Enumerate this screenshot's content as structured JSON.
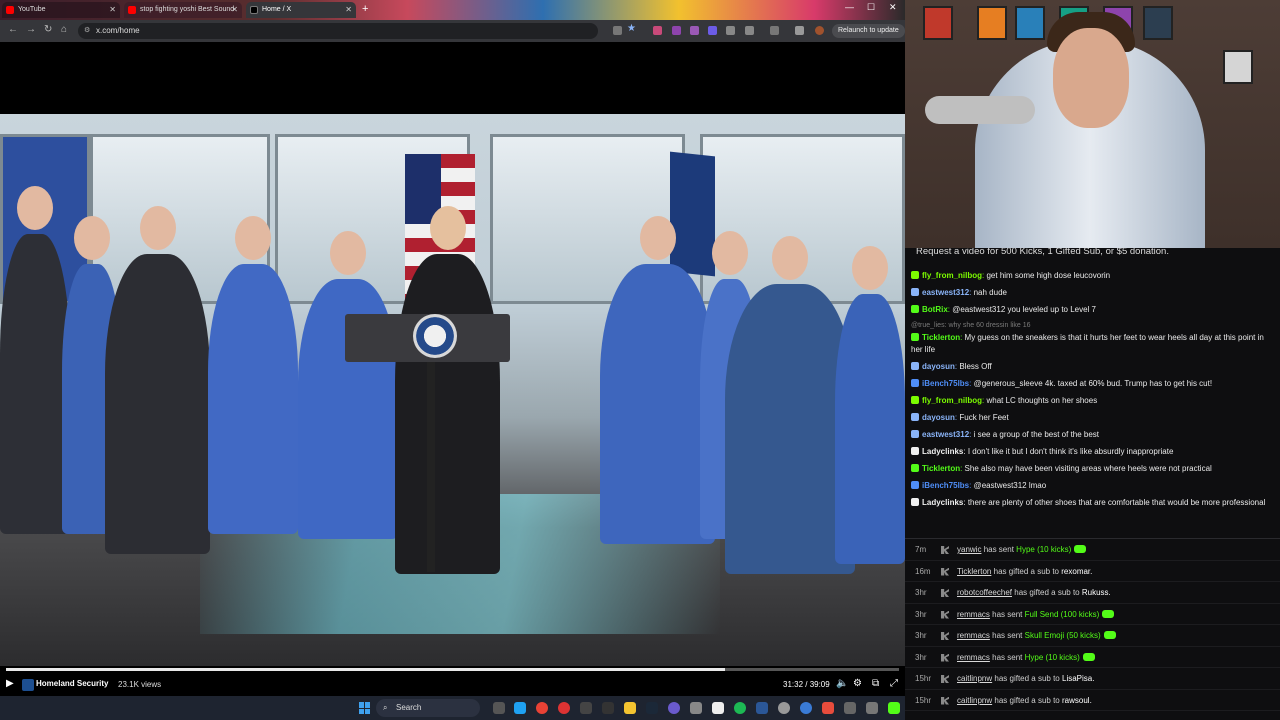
{
  "browser": {
    "tabs": [
      {
        "label": "YouTube"
      },
      {
        "label": "stop fighting yoshi Best Sound"
      },
      {
        "label": "Home / X"
      }
    ],
    "new_tab": "+",
    "url": "x.com/home",
    "relaunch_label": "Relaunch to update"
  },
  "video": {
    "channel": "Homeland Security",
    "views": "23.1K views",
    "time": "31:32 / 39:09",
    "progress_fraction": 0.805
  },
  "chat": {
    "banner": "Request a video for 500 Kicks, 1 Gifted Sub, or $5 donation.",
    "messages": [
      {
        "user": "fly_from_nilbog",
        "text": "get him some high dose leucovorin",
        "color": "#7cfc00"
      },
      {
        "user": "eastwest312",
        "text": "nah dude",
        "color": "#8ab4f8"
      },
      {
        "user": "BotRix",
        "text": "@eastwest312 you leveled up to Level 7",
        "color": "#53fc18"
      },
      {
        "deleted": "@true_lies: why she 60 dressin like 16"
      },
      {
        "user": "Ticklerton",
        "text": "My guess on the sneakers is that it hurts her feet to wear heels all day at this point in her life",
        "color": "#53fc18"
      },
      {
        "user": "dayosun",
        "text": "Bless Off",
        "color": "#8ab4f8"
      },
      {
        "user": "iBench75lbs",
        "text": "@generous_sleeve 4k. taxed at 60% bud. Trump has to get his cut!",
        "color": "#4f8ef7"
      },
      {
        "user": "fly_from_nilbog",
        "text": "what LC thoughts on her shoes",
        "color": "#7cfc00"
      },
      {
        "user": "dayosun",
        "text": "Fuck her Feet",
        "color": "#8ab4f8"
      },
      {
        "user": "eastwest312",
        "text": "i see a group of the best of the best",
        "color": "#8ab4f8"
      },
      {
        "user": "Ladyclinks",
        "text": "I don't like it but I don't think it's like absurdly inappropriate",
        "color": "#f0f0f0"
      },
      {
        "user": "Ticklerton",
        "text": "She also may have been visiting areas where heels were not practical",
        "color": "#53fc18"
      },
      {
        "user": "iBench75lbs",
        "text": "@eastwest312 lmao",
        "color": "#4f8ef7"
      },
      {
        "user": "Ladyclinks",
        "text": "there are plenty of other shoes that are comfortable that would be more professional",
        "color": "#f0f0f0"
      }
    ],
    "events": [
      {
        "time": "7m",
        "name": "yanwic",
        "action": "has sent",
        "gift": "Hype (10 kicks)",
        "kick": true
      },
      {
        "time": "16m",
        "name": "Ticklerton",
        "action": "has gifted a sub to",
        "gift": "rexomar.",
        "kick": false
      },
      {
        "time": "3hr",
        "name": "robotcoffeechef",
        "action": "has gifted a sub to",
        "gift": "Rukuss.",
        "kick": false
      },
      {
        "time": "3hr",
        "name": "remmacs",
        "action": "has sent",
        "gift": "Full Send (100 kicks)",
        "kick": true
      },
      {
        "time": "3hr",
        "name": "remmacs",
        "action": "has sent",
        "gift": "Skull Emoji (50 kicks)",
        "kick": true
      },
      {
        "time": "3hr",
        "name": "remmacs",
        "action": "has sent",
        "gift": "Hype (10 kicks)",
        "kick": true
      },
      {
        "time": "15hr",
        "name": "caitlinpnw",
        "action": "has gifted a sub to",
        "gift": "LisaPisa.",
        "kick": false
      },
      {
        "time": "15hr",
        "name": "caitlinpnw",
        "action": "has gifted a sub to",
        "gift": "rawsoul.",
        "kick": false
      }
    ]
  },
  "taskbar": {
    "search_label": "Search"
  },
  "colors": {
    "kick_green": "#53fc18",
    "chat_bg": "#0e0e10",
    "taskbar_bg": "#1e2430"
  }
}
